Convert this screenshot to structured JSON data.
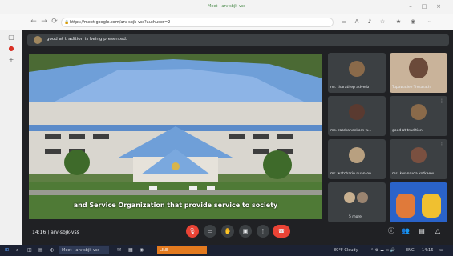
{
  "browser": {
    "tab_title": "Meet - arv-sbjk-vss",
    "url": "https://meet.google.com/arv-sbjk-vss?authuser=2",
    "window_buttons": [
      "–",
      "□",
      "×"
    ],
    "nav_icons": [
      "back-icon",
      "forward-icon",
      "reload-icon"
    ],
    "toolbar_icons": [
      "camera-icon",
      "translate-icon",
      "read-aloud-icon",
      "favorite-icon",
      "favorites-list-icon",
      "profile-icon",
      "more-icon"
    ]
  },
  "notification": {
    "text": "good at tradition is being presented."
  },
  "presentation": {
    "caption": "and Service Organization that provide service to society"
  },
  "participants": [
    {
      "name": "mr. tharathep adverb",
      "avatar_color": "#8a6a4a"
    },
    {
      "name": "Tupawadee Tresarath",
      "avatar_color": "#c9a68a"
    },
    {
      "name": "ms. ratchaneekorn w...",
      "avatar_color": "#5a3a30"
    },
    {
      "name": "good at tradition.",
      "avatar_color": "#8a6a4a"
    },
    {
      "name": "mr. watcharin nuan-on",
      "avatar_color": "#b8a080"
    },
    {
      "name": "ms. kwanruda kotkaew",
      "avatar_color": "#7a5040"
    },
    {
      "name": "5 more.",
      "avatar_color": "#c8b090"
    }
  ],
  "meeting": {
    "time": "14:16",
    "code": "arv-sbjk-vss"
  },
  "taskbar": {
    "meet_item": "Meet - arv-sbjk-vss",
    "line_item": "LINE",
    "weather": "89°F Cloudy",
    "lang": "ENG",
    "clock": "14:16"
  },
  "colors": {
    "meet_bg": "#202124",
    "tile_bg": "#3c4043",
    "end_call": "#ea4335",
    "taskbar": "#1c2233"
  }
}
